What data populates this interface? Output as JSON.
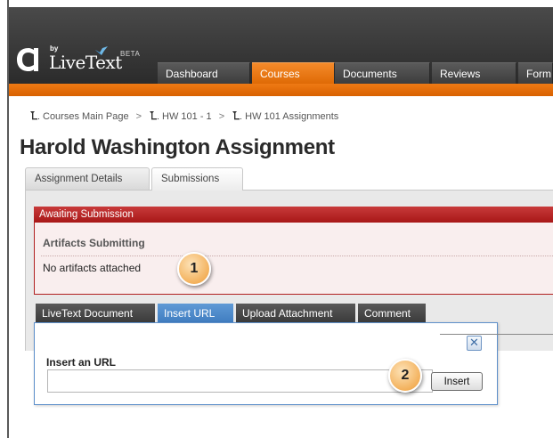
{
  "brand": {
    "logo_mark": "C1",
    "by": "by",
    "name": "LiveText",
    "beta": "BETA"
  },
  "nav": {
    "tabs": [
      {
        "label": "Dashboard"
      },
      {
        "label": "Courses"
      },
      {
        "label": "Documents"
      },
      {
        "label": "Reviews"
      },
      {
        "label": "Form"
      }
    ],
    "active": "Courses"
  },
  "breadcrumb": {
    "items": [
      {
        "label": "Courses Main Page"
      },
      {
        "label": "HW 101 - 1"
      },
      {
        "label": "HW 101 Assignments"
      }
    ],
    "separator": ">"
  },
  "page": {
    "title": "Harold Washington Assignment"
  },
  "subtabs": [
    {
      "label": "Assignment Details"
    },
    {
      "label": "Submissions"
    }
  ],
  "status": {
    "header": "Awaiting Submission",
    "artifacts_title": "Artifacts Submitting",
    "artifacts_empty": "No artifacts attached"
  },
  "callouts": {
    "one": "1",
    "two": "2"
  },
  "actions": {
    "tabs": [
      {
        "label": "LiveText Document"
      },
      {
        "label": "Insert URL"
      },
      {
        "label": "Upload Attachment"
      },
      {
        "label": "Comment"
      }
    ],
    "active": "Insert URL"
  },
  "insert_url": {
    "label": "Insert an URL",
    "value": "",
    "button": "Insert",
    "close_icon": "close-icon"
  },
  "colors": {
    "header_bg": "#2b2b2b",
    "accent_orange": "#ef7a14",
    "alert_red": "#b02020",
    "tab_blue": "#4a86c8"
  }
}
